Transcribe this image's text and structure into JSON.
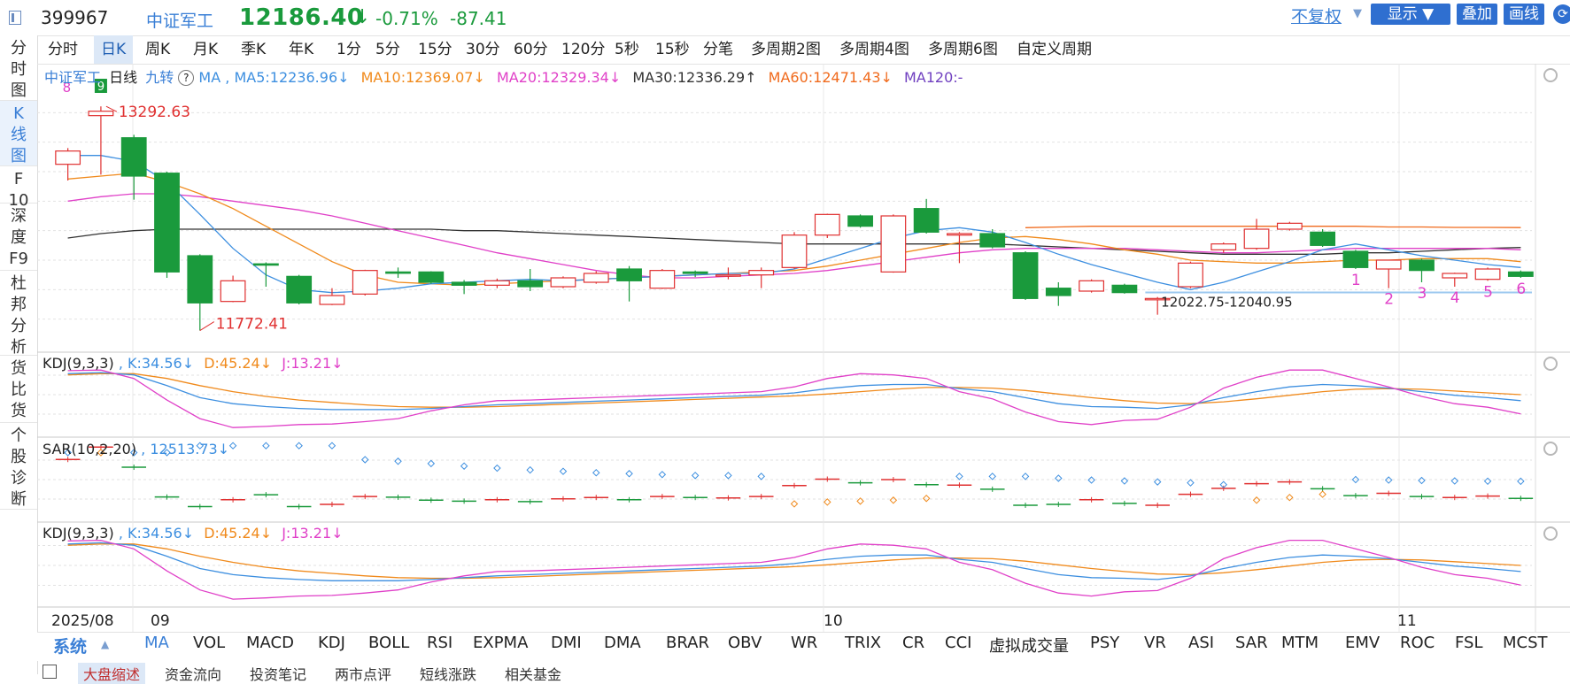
{
  "header": {
    "code": "399967",
    "name": "中证军工",
    "price": "12186.40",
    "price_arrow": "↓",
    "change_pct": "-0.71%",
    "change_value": "-87.41",
    "color_down": "#1a9a3c",
    "color_up": "#e03030"
  },
  "sidebar": {
    "items": [
      {
        "label": "分\n时\n图",
        "active": false
      },
      {
        "label": "K\n线\n图",
        "active": true
      },
      {
        "label": "F\n10",
        "active": false
      },
      {
        "label": "深\n度\nF9",
        "active": false
      },
      {
        "label": "杜\n邦\n分\n析",
        "active": false
      },
      {
        "label": "货\n比\n货",
        "active": false
      },
      {
        "label": "个\n股\n诊\n断",
        "active": false
      }
    ]
  },
  "toolbar": {
    "periods": [
      "分时",
      "日K",
      "周K",
      "月K",
      "季K",
      "年K",
      "1分",
      "5分",
      "15分",
      "30分",
      "60分",
      "120分",
      "5秒",
      "15秒",
      "分笔",
      "多周期2图",
      "多周期4图",
      "多周期6图",
      "自定义周期"
    ],
    "active_period": "日K",
    "fq_label": "不复权",
    "fq_arrow": "▼",
    "show_label": "显示",
    "overlay_label": "叠加",
    "draw_label": "画线",
    "accent": "#2f6fd0"
  },
  "main_legend": {
    "name": "中证军工",
    "period": "日线",
    "nine": "九转",
    "help": "?",
    "ma": "MA",
    "ma5": "MA5:12236.96↓",
    "ma10": "MA10:12369.07↓",
    "ma20": "MA20:12329.34↓",
    "ma30": "MA30:12336.29↑",
    "ma60": "MA60:12471.43↓",
    "ma120": "MA120:-",
    "ma5_color": "#3d8fe0",
    "ma10_color": "#f08a1c",
    "ma20_color": "#e040c8",
    "ma30_color": "#333333",
    "ma60_color": "#f06a1c",
    "ma120_color": "#7040c0"
  },
  "annotations": {
    "high_label": "13292.63",
    "low_label": "11772.41",
    "range_label": "12022.75-12040.95",
    "nine_top_1": "8",
    "nine_top_2": "9",
    "nine_bottom": [
      "1",
      "2",
      "3",
      "4",
      "5",
      "6"
    ]
  },
  "kdj_legend": {
    "name": "KDJ(9,3,3)",
    "k": ", K:34.56↓",
    "d": "D:45.24↓",
    "j": "J:13.21↓"
  },
  "sar_legend": {
    "name": "SAR(10,2,20)",
    "value": ", 12513.73↓"
  },
  "kdj2_legend": {
    "name": "KDJ(9,3,3)",
    "k": ", K:34.56↓",
    "d": "D:45.24↓",
    "j": "J:13.21↓"
  },
  "x_axis": {
    "labels": [
      "2025/08",
      "09",
      "10",
      "11"
    ]
  },
  "indicator_tabs": {
    "system_label": "系统",
    "system_arrow": "▲",
    "tabs": [
      "MA",
      "VOL",
      "MACD",
      "KDJ",
      "BOLL",
      "RSI",
      "EXPMA",
      "DMI",
      "DMA",
      "BRAR",
      "OBV",
      "WR",
      "TRIX",
      "CR",
      "CCI",
      "虚拟成交量",
      "PSY",
      "VR",
      "ASI",
      "SAR",
      "MTM",
      "EMV",
      "ROC",
      "FSL",
      "MCST"
    ],
    "active": "MA"
  },
  "lower_tabs": [
    "大盘缩述",
    "资金流向",
    "投资笔记",
    "两市点评",
    "短线涨跌",
    "相关基金"
  ],
  "chart_data": {
    "type": "candlestick",
    "y_range": [
      11650,
      13450
    ],
    "candles": [
      {
        "o": 12900,
        "c": 12990,
        "h": 13010,
        "l": 12790
      },
      {
        "o": 13230,
        "c": 13260,
        "h": 13292.63,
        "l": 12830
      },
      {
        "o": 13080,
        "c": 12820,
        "h": 13100,
        "l": 12660
      },
      {
        "o": 12840,
        "c": 12170,
        "h": 12850,
        "l": 12130
      },
      {
        "o": 12280,
        "c": 11960,
        "h": 12290,
        "l": 11772.41
      },
      {
        "o": 11970,
        "c": 12110,
        "h": 12145,
        "l": 11965
      },
      {
        "o": 12225,
        "c": 12220,
        "h": 12235,
        "l": 12070
      },
      {
        "o": 12140,
        "c": 11960,
        "h": 12150,
        "l": 11950
      },
      {
        "o": 11950,
        "c": 12010,
        "h": 12060,
        "l": 11945
      },
      {
        "o": 12020,
        "c": 12180,
        "h": 12185,
        "l": 12010
      },
      {
        "o": 12170,
        "c": 12165,
        "h": 12200,
        "l": 12130
      },
      {
        "o": 12170,
        "c": 12100,
        "h": 12175,
        "l": 12090
      },
      {
        "o": 12100,
        "c": 12080,
        "h": 12115,
        "l": 12020
      },
      {
        "o": 12080,
        "c": 12110,
        "h": 12125,
        "l": 12060
      },
      {
        "o": 12110,
        "c": 12070,
        "h": 12190,
        "l": 12040
      },
      {
        "o": 12070,
        "c": 12130,
        "h": 12140,
        "l": 12060
      },
      {
        "o": 12100,
        "c": 12160,
        "h": 12175,
        "l": 12090
      },
      {
        "o": 12190,
        "c": 12110,
        "h": 12210,
        "l": 11970
      },
      {
        "o": 12060,
        "c": 12180,
        "h": 12190,
        "l": 12055
      },
      {
        "o": 12170,
        "c": 12160,
        "h": 12180,
        "l": 12135
      },
      {
        "o": 12150,
        "c": 12150,
        "h": 12200,
        "l": 12120
      },
      {
        "o": 12150,
        "c": 12180,
        "h": 12200,
        "l": 12060
      },
      {
        "o": 12200,
        "c": 12420,
        "h": 12440,
        "l": 12190
      },
      {
        "o": 12420,
        "c": 12560,
        "h": 12565,
        "l": 12400
      },
      {
        "o": 12550,
        "c": 12480,
        "h": 12560,
        "l": 12470
      },
      {
        "o": 12170,
        "c": 12550,
        "h": 12560,
        "l": 12165
      },
      {
        "o": 12600,
        "c": 12440,
        "h": 12665,
        "l": 12430
      },
      {
        "o": 12420,
        "c": 12430,
        "h": 12440,
        "l": 12230
      },
      {
        "o": 12430,
        "c": 12340,
        "h": 12460,
        "l": 12330
      },
      {
        "o": 12300,
        "c": 11990,
        "h": 12310,
        "l": 11980
      },
      {
        "o": 12060,
        "c": 12010,
        "h": 12100,
        "l": 11940
      },
      {
        "o": 12040,
        "c": 12110,
        "h": 12120,
        "l": 12030
      },
      {
        "o": 12080,
        "c": 12030,
        "h": 12090,
        "l": 12022.75
      },
      {
        "o": 11990,
        "c": 11990,
        "h": 12000,
        "l": 11880
      },
      {
        "o": 12070,
        "c": 12230,
        "h": 12240,
        "l": 12060
      },
      {
        "o": 12320,
        "c": 12360,
        "h": 12370,
        "l": 12300
      },
      {
        "o": 12330,
        "c": 12460,
        "h": 12530,
        "l": 12320
      },
      {
        "o": 12460,
        "c": 12500,
        "h": 12510,
        "l": 12450
      },
      {
        "o": 12440,
        "c": 12350,
        "h": 12460,
        "l": 12340
      },
      {
        "o": 12310,
        "c": 12200,
        "h": 12320,
        "l": 12190
      },
      {
        "o": 12190,
        "c": 12250,
        "h": 12250,
        "l": 12060
      },
      {
        "o": 12250,
        "c": 12180,
        "h": 12260,
        "l": 12100
      },
      {
        "o": 12130,
        "c": 12160,
        "h": 12165,
        "l": 12070
      },
      {
        "o": 12120,
        "c": 12190,
        "h": 12200,
        "l": 12110
      },
      {
        "o": 12170,
        "c": 12140,
        "h": 12180,
        "l": 12130
      }
    ],
    "ma5": [
      12960,
      12960,
      12920,
      12780,
      12560,
      12330,
      12150,
      12050,
      12030,
      12040,
      12060,
      12090,
      12100,
      12110,
      12120,
      12110,
      12120,
      12130,
      12140,
      12150,
      12160,
      12160,
      12190,
      12260,
      12330,
      12400,
      12450,
      12470,
      12440,
      12370,
      12290,
      12220,
      12160,
      12100,
      12050,
      12100,
      12170,
      12240,
      12320,
      12360,
      12320,
      12280,
      12250,
      12220,
      12200
    ],
    "ma10": [
      12800,
      12820,
      12840,
      12780,
      12700,
      12600,
      12480,
      12360,
      12240,
      12150,
      12100,
      12090,
      12080,
      12090,
      12100,
      12110,
      12120,
      12130,
      12140,
      12150,
      12160,
      12170,
      12180,
      12210,
      12250,
      12290,
      12330,
      12370,
      12400,
      12410,
      12390,
      12360,
      12320,
      12290,
      12250,
      12240,
      12230,
      12230,
      12240,
      12250,
      12250,
      12260,
      12260,
      12260,
      12240
    ],
    "ma20": [
      12650,
      12680,
      12700,
      12700,
      12680,
      12650,
      12620,
      12590,
      12550,
      12500,
      12450,
      12400,
      12350,
      12300,
      12260,
      12220,
      12180,
      12150,
      12130,
      12130,
      12140,
      12150,
      12160,
      12180,
      12210,
      12240,
      12270,
      12300,
      12320,
      12330,
      12330,
      12330,
      12330,
      12320,
      12310,
      12300,
      12300,
      12310,
      12320,
      12330,
      12330,
      12330,
      12330,
      12330,
      12320
    ],
    "ma30": [
      12400,
      12430,
      12450,
      12460,
      12460,
      12460,
      12460,
      12460,
      12460,
      12460,
      12460,
      12460,
      12450,
      12450,
      12440,
      12430,
      12420,
      12410,
      12400,
      12390,
      12380,
      12370,
      12360,
      12360,
      12360,
      12360,
      12360,
      12360,
      12360,
      12350,
      12340,
      12330,
      12320,
      12310,
      12300,
      12290,
      12290,
      12290,
      12290,
      12300,
      12300,
      12310,
      12320,
      12330,
      12336
    ],
    "ma60": [
      null,
      null,
      null,
      null,
      null,
      null,
      null,
      null,
      null,
      null,
      null,
      null,
      null,
      null,
      null,
      null,
      null,
      null,
      null,
      null,
      null,
      null,
      null,
      null,
      null,
      null,
      null,
      null,
      null,
      12470,
      12475,
      12480,
      12480,
      12480,
      12480,
      12480,
      12480,
      12480,
      12480,
      12480,
      12475,
      12475,
      12472,
      12472,
      12471
    ],
    "kdj_k": [
      80,
      82,
      78,
      60,
      40,
      30,
      25,
      22,
      20,
      20,
      20,
      22,
      25,
      28,
      30,
      32,
      34,
      36,
      38,
      40,
      42,
      44,
      48,
      55,
      60,
      62,
      62,
      55,
      50,
      40,
      30,
      25,
      24,
      22,
      28,
      40,
      50,
      58,
      62,
      60,
      56,
      50,
      44,
      40,
      35
    ],
    "kdj_d": [
      78,
      80,
      80,
      72,
      60,
      50,
      42,
      36,
      32,
      28,
      25,
      24,
      24,
      25,
      27,
      29,
      31,
      33,
      35,
      37,
      39,
      41,
      43,
      46,
      50,
      54,
      57,
      57,
      56,
      52,
      46,
      40,
      35,
      31,
      30,
      33,
      38,
      44,
      50,
      54,
      55,
      54,
      51,
      48,
      45
    ],
    "kdj_j": [
      85,
      86,
      72,
      36,
      5,
      -10,
      -8,
      -5,
      -4,
      0,
      5,
      18,
      28,
      35,
      36,
      38,
      40,
      42,
      44,
      46,
      48,
      50,
      58,
      72,
      80,
      78,
      72,
      50,
      38,
      16,
      0,
      -5,
      2,
      4,
      24,
      56,
      74,
      86,
      86,
      72,
      58,
      42,
      30,
      24,
      13
    ],
    "sar": [
      13140,
      13140,
      13140,
      13140,
      13290,
      13290,
      13290,
      13290,
      13290,
      12985,
      12950,
      12900,
      12845,
      12800,
      12760,
      12730,
      12700,
      12680,
      12660,
      12640,
      12640,
      12620,
      12020,
      12060,
      12080,
      12100,
      12140,
      12620,
      12620,
      12620,
      12580,
      12540,
      12520,
      12500,
      12480,
      12440,
      12100,
      12160,
      12230,
      12550,
      12540,
      12530,
      12520,
      12515,
      12513.73
    ]
  }
}
